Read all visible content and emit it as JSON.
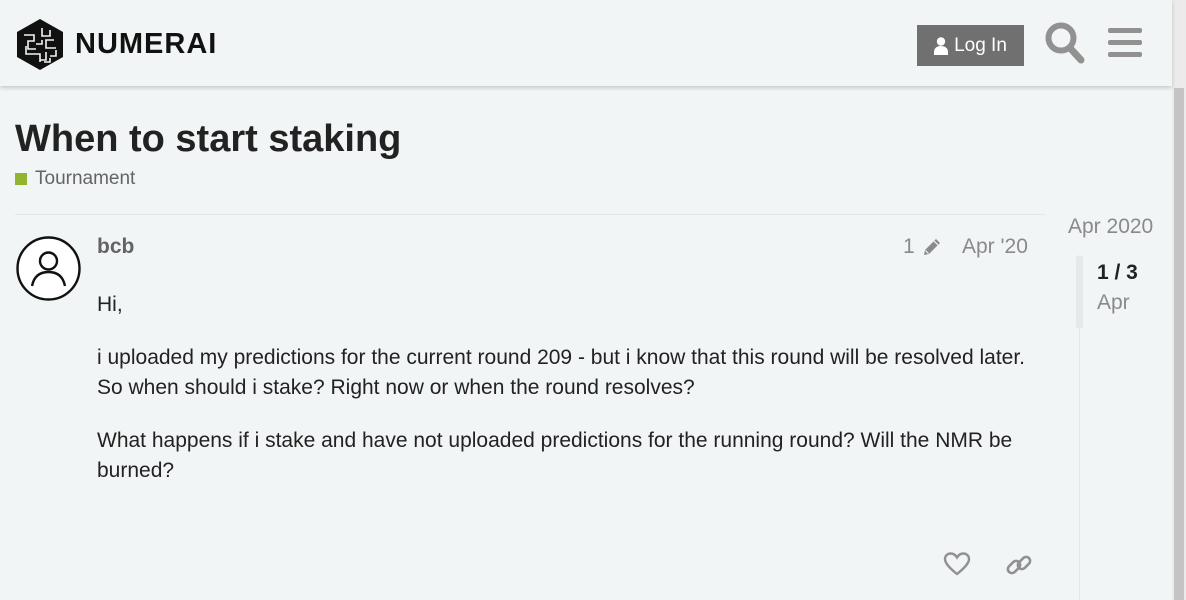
{
  "header": {
    "logo_text": "NUMERAI",
    "login_label": "Log In"
  },
  "topic": {
    "title": "When to start staking",
    "category": "Tournament",
    "category_color": "#92b52f"
  },
  "post": {
    "username": "bcb",
    "edit_count": "1",
    "date": "Apr '20",
    "paragraphs": [
      "Hi,",
      "i uploaded my predictions for the current round 209 - but i know that this round will be resolved later. So when should i stake? Right now or when the round resolves?",
      "What happens if i stake and have not uploaded predictions for the running round? Will the NMR be burned?"
    ]
  },
  "timeline": {
    "start_date": "Apr 2020",
    "position": "1 / 3",
    "current_date": "Apr"
  },
  "icons": {
    "logo": "numerai-logo-icon",
    "login": "user-icon",
    "search": "search-icon",
    "menu": "hamburger-menu-icon",
    "avatar": "default-avatar-icon",
    "edit": "pencil-icon",
    "like": "heart-icon",
    "link": "link-icon"
  },
  "colors": {
    "background": "#f2f5f6",
    "login_button": "#707070",
    "header_icons": "#919191"
  }
}
